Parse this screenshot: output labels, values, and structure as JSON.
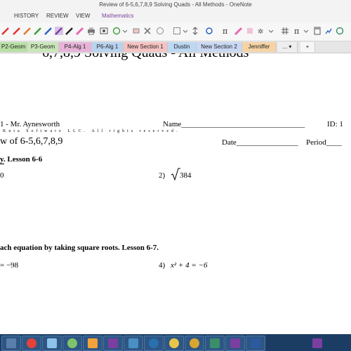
{
  "window": {
    "title": "Review of 6-5,6,7,8,9 Solving Quads - All Methods - OneNote"
  },
  "menu": {
    "items": [
      "HISTORY",
      "REVIEW",
      "VIEW",
      "Mathematics"
    ]
  },
  "section_tabs": [
    {
      "label": "P2-Geom",
      "color": "#b7dfa4"
    },
    {
      "label": "P3-Geom",
      "color": "#c9e6b8"
    },
    {
      "label": "P4-Alg 1",
      "color": "#e7b3d8"
    },
    {
      "label": "P6-Alg 1",
      "color": "#b8d3ee"
    },
    {
      "label": "New Section 1",
      "color": "#f6c2c2"
    },
    {
      "label": "Dustin",
      "color": "#bcd8f2"
    },
    {
      "label": "New Section 2",
      "color": "#c8d8f4"
    },
    {
      "label": "Jenniffer",
      "color": "#f6d3a5"
    },
    {
      "label": "...",
      "color": "#eeeeee"
    },
    {
      "label": "+",
      "color": "#f6f6f6"
    }
  ],
  "page": {
    "title": "6,7,8,9 Solving Quads - All Methods",
    "class_line": "1 - Mr. Aynesworth",
    "name_label": "Name________________________________",
    "id_label": "ID: 1",
    "copyright": "Kuta Software LLC. All rights reserved.",
    "review_title": "w of 6-5,6,7,8,9",
    "date_label": "Date________________",
    "period_label": "Period____",
    "section1_header": "y.  Lesson 6-6",
    "q1_partial": "0",
    "q2_number": "2)",
    "q2_radicand": "384",
    "section2_header": "ach equation by taking square roots.  Lesson 6-7.",
    "q3_partial": "= −98",
    "q4_number": "4)",
    "q4_equation": "x² + 4 = −6"
  },
  "taskbar": {
    "apps": [
      {
        "name": "windows-start",
        "color": "#5b7fad"
      },
      {
        "name": "chrome",
        "color": "#e2423a"
      },
      {
        "name": "paint",
        "color": "#8ec2ea"
      },
      {
        "name": "geogebra",
        "color": "#7ec26a"
      },
      {
        "name": "media",
        "color": "#f2a23b"
      },
      {
        "name": "onenote",
        "color": "#7a3fa0"
      },
      {
        "name": "calculator",
        "color": "#4a8fc4"
      },
      {
        "name": "lens",
        "color": "#2a6fb0"
      },
      {
        "name": "geogebra-2",
        "color": "#e9c54a"
      },
      {
        "name": "chrome-2",
        "color": "#d8a72f"
      },
      {
        "name": "app-11",
        "color": "#3a8f6a"
      },
      {
        "name": "onenote-2",
        "color": "#7a3fa0"
      },
      {
        "name": "word",
        "color": "#2b5b9e"
      }
    ]
  },
  "colors": {
    "accent_purple": "#7a3fa0",
    "taskbar_bg": "#1c3d63"
  }
}
